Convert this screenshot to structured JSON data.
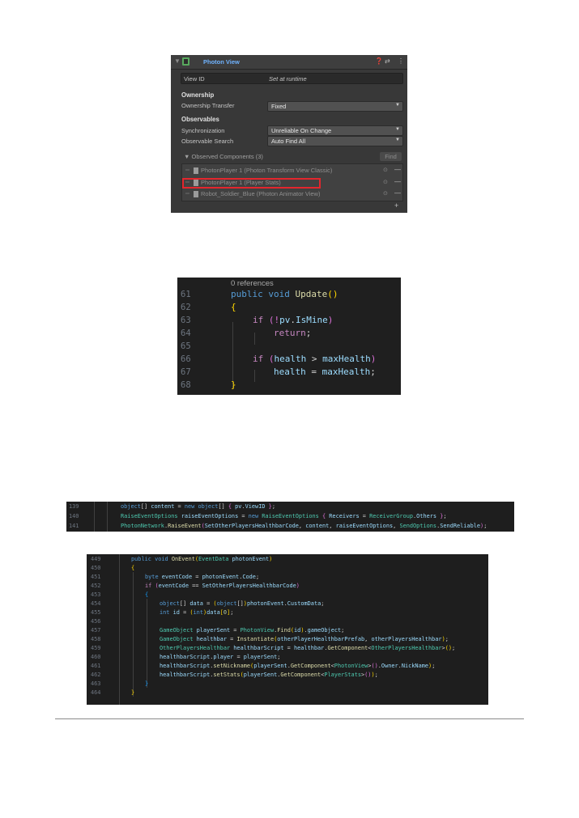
{
  "inspector": {
    "title": "Photon View",
    "header_icons": [
      "help-icon",
      "settings-sliders-icon",
      "more-menu-icon"
    ],
    "view_id": {
      "label": "View ID",
      "value": "Set at runtime"
    },
    "ownership": {
      "section": "Ownership",
      "transfer_label": "Ownership Transfer",
      "transfer_value": "Fixed"
    },
    "observables": {
      "section": "Observables",
      "sync_label": "Synchronization",
      "sync_value": "Unreliable On Change",
      "search_label": "Observable Search",
      "search_value": "Auto Find All"
    },
    "observed": {
      "header": "Observed Components (3)",
      "find_button": "Find",
      "items": [
        "PhotonPlayer 1 (Photon Transform View Classic)",
        "PhotonPlayer 1 (Player Stats)",
        "Robot_Soldier_Blue (Photon Animator View)"
      ],
      "highlighted_index": 1,
      "highlight_color": "#e3262d"
    }
  },
  "snippet1": {
    "references": "0 references",
    "lines": [
      {
        "n": "61"
      },
      {
        "n": "62"
      },
      {
        "n": "63"
      },
      {
        "n": "64"
      },
      {
        "n": "65"
      },
      {
        "n": "66"
      },
      {
        "n": "67"
      },
      {
        "n": "68"
      }
    ],
    "code": {
      "l61": [
        "public",
        "void",
        "Update",
        "()"
      ],
      "l62": "{",
      "l63": [
        "if",
        "(!",
        "pv",
        ".",
        "IsMine",
        ")"
      ],
      "l64": [
        "return",
        ";"
      ],
      "l66": [
        "if",
        "(",
        "health",
        " > ",
        "maxHealth",
        ")"
      ],
      "l67": [
        "health",
        " = ",
        "maxHealth",
        ";"
      ],
      "l68": "}"
    }
  },
  "snippet2": {
    "line_numbers": [
      "139",
      "140",
      "141"
    ],
    "lines": [
      "object[] content = new object[] { pv.ViewID };",
      "RaiseEventOptions raiseEventOptions = new RaiseEventOptions { Receivers = ReceiverGroup.Others };",
      "PhotonNetwork.RaiseEvent(SetOtherPlayersHealthbarCode, content, raiseEventOptions, SendOptions.SendReliable);"
    ]
  },
  "snippet3": {
    "line_numbers": [
      "449",
      "450",
      "451",
      "452",
      "453",
      "454",
      "455",
      "456",
      "457",
      "458",
      "459",
      "460",
      "461",
      "462",
      "463",
      "464"
    ],
    "lines": [
      "public void OnEvent(EventData photonEvent)",
      "{",
      "byte eventCode = photonEvent.Code;",
      "if (eventCode == SetOtherPlayersHealthbarCode)",
      "{",
      "object[] data = (object[])photonEvent.CustomData;",
      "int id = (int)data[0];",
      "",
      "GameObject playerSent = PhotonView.Find(id).gameObject;",
      "GameObject healthbar = Instantiate(otherPlayerHealthbarPrefab, otherPlayersHealthbar);",
      "OtherPlayersHealthbar healthbarScript = healthbar.GetComponent<OtherPlayersHealthbar>();",
      "healthbarScript.player = playerSent;",
      "healthbarScript.setNickname(playerSent.GetComponent<PhotonView>().Owner.NickName);",
      "healthbarScript.setStats(playerSent.GetComponent<PlayerStats>());",
      "}",
      "}"
    ]
  }
}
